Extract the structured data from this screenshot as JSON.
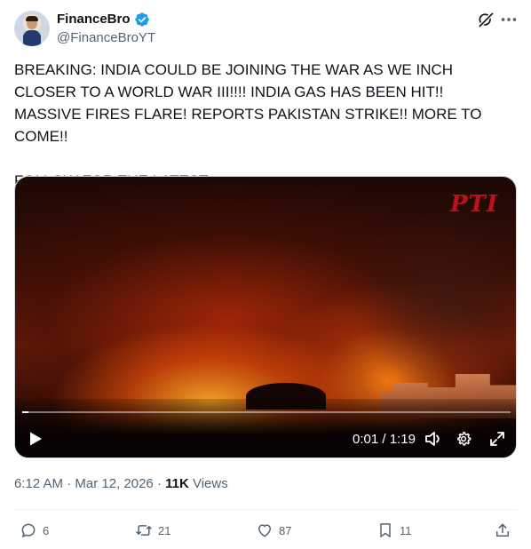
{
  "author": {
    "name": "FinanceBro",
    "handle": "@FinanceBroYT",
    "verified": true,
    "verified_color": "#1d9bf0"
  },
  "header_icons": [
    "grok-icon",
    "more-icon"
  ],
  "tweet": {
    "text": "BREAKING: INDIA COULD BE JOINING THE WAR AS WE INCH CLOSER TO A WORLD WAR III!!!! INDIA GAS HAS BEEN HIT!! MASSIVE FIRES FLARE! REPORTS PAKISTAN STRIKE!! MORE TO COME!!\n\nFOLLOW FOR THE LATEST"
  },
  "video": {
    "watermark": "PTI",
    "current_time": "0:01",
    "separator": " / ",
    "duration": "1:19",
    "progress_fraction": 0.013
  },
  "meta": {
    "time": "6:12 AM",
    "dot1": " · ",
    "date": "Mar 12, 2026",
    "dot2": " · ",
    "views_count": "11K",
    "views_label": " Views"
  },
  "actions": {
    "replies": "6",
    "reposts": "21",
    "likes": "87",
    "bookmarks": "11"
  }
}
